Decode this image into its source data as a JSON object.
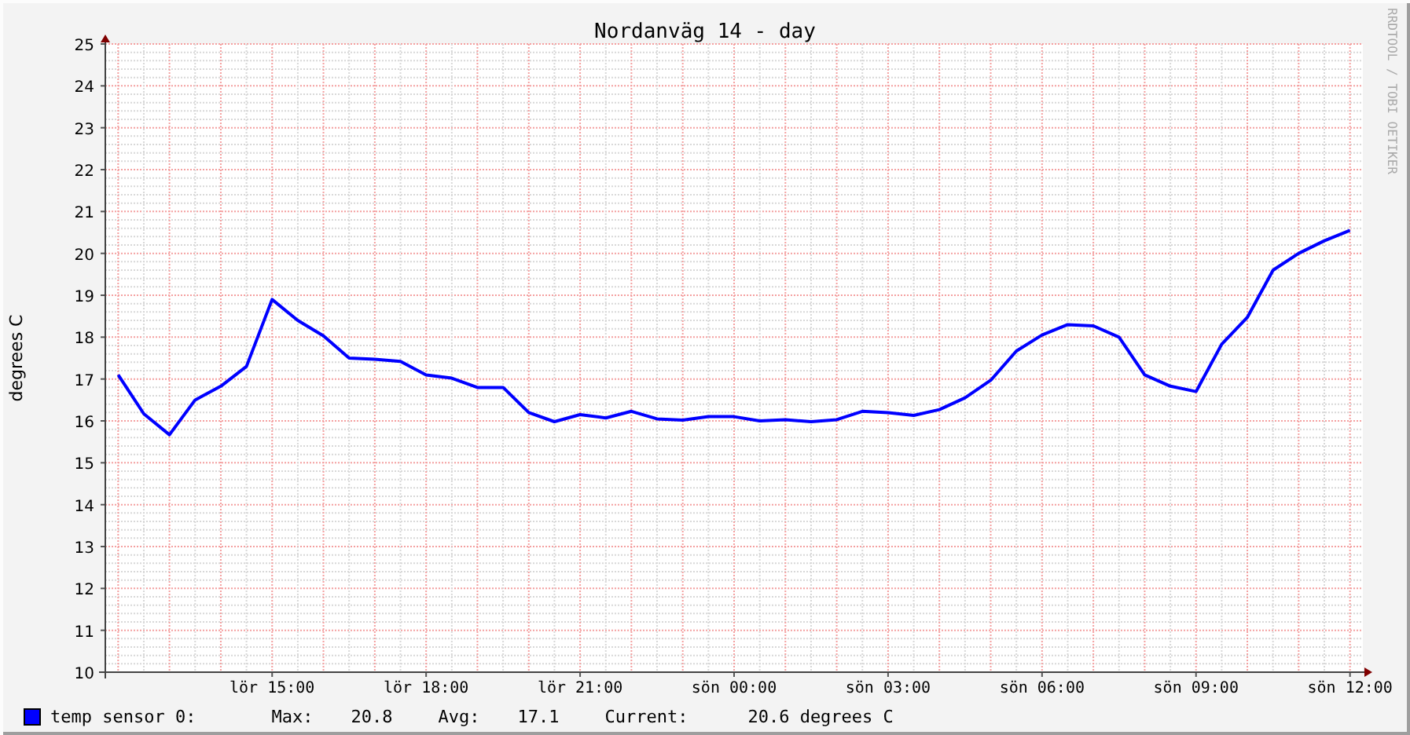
{
  "credit": "RRDTOOL / TOBI OETIKER",
  "chart_data": {
    "type": "line",
    "title": "Nordanväg 14 - day",
    "ylabel": "degrees C",
    "ylim": [
      10,
      25
    ],
    "grid": true,
    "yticks": [
      10,
      11,
      12,
      13,
      14,
      15,
      16,
      17,
      18,
      19,
      20,
      21,
      22,
      23,
      24,
      25
    ],
    "categories": [
      null,
      null,
      null,
      null,
      null,
      null,
      "lör 15:00",
      null,
      null,
      null,
      null,
      null,
      "lör 18:00",
      null,
      null,
      null,
      null,
      null,
      "lör 21:00",
      null,
      null,
      null,
      null,
      null,
      "sön 00:00",
      null,
      null,
      null,
      null,
      null,
      "sön 03:00",
      null,
      null,
      null,
      null,
      null,
      "sön 06:00",
      null,
      null,
      null,
      null,
      null,
      "sön 09:00",
      null,
      null,
      null,
      null,
      null,
      "sön 12:00"
    ],
    "series": [
      {
        "name": "temp sensor 0:",
        "color": "#0000ff",
        "values": [
          17.1,
          16.17,
          15.67,
          16.5,
          16.83,
          17.3,
          18.9,
          18.4,
          18.03,
          17.5,
          17.47,
          17.42,
          17.1,
          17.02,
          16.8,
          16.8,
          16.2,
          15.98,
          16.15,
          16.07,
          16.23,
          16.05,
          16.02,
          16.1,
          16.1,
          16.0,
          16.03,
          15.98,
          16.03,
          16.23,
          16.2,
          16.13,
          16.27,
          16.55,
          16.97,
          17.67,
          18.05,
          18.3,
          18.27,
          18.0,
          17.1,
          16.83,
          16.7,
          17.83,
          18.47,
          19.6,
          20.0,
          20.3,
          20.55
        ]
      }
    ]
  },
  "legend": {
    "max_label": "Max:",
    "max": "20.8",
    "avg_label": "Avg:",
    "avg": "17.1",
    "current_label": "Current:",
    "current": "20.6 degrees C"
  }
}
